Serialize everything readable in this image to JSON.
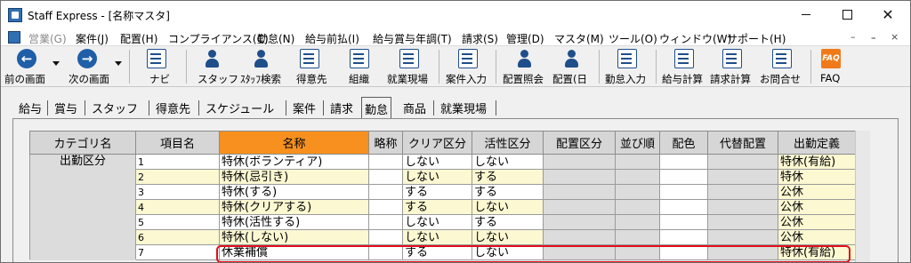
{
  "window": {
    "title": "Staff Express - [名称マスタ]",
    "controls": {
      "close": "✕"
    }
  },
  "menu": {
    "items": [
      {
        "label": "営業(G)",
        "enabled": false
      },
      {
        "label": "案件(J)",
        "enabled": true
      },
      {
        "label": "配置(H)",
        "enabled": true
      },
      {
        "label": "コンプライアンス(C)",
        "enabled": true
      },
      {
        "label": "勤怠(N)",
        "enabled": true
      },
      {
        "label": "給与前払(I)",
        "enabled": true
      },
      {
        "label": "給与賞与年調(T)",
        "enabled": true
      },
      {
        "label": "請求(S)",
        "enabled": true
      },
      {
        "label": "管理(D)",
        "enabled": true
      },
      {
        "label": "マスタ(M)",
        "enabled": true
      },
      {
        "label": "ツール(O)",
        "enabled": true
      },
      {
        "label": "ウィンドウ(W)",
        "enabled": true
      },
      {
        "label": "サポート(H)",
        "enabled": true
      }
    ],
    "mdi_controls": [
      "–",
      "ｰ",
      "×"
    ]
  },
  "toolbar": {
    "buttons": [
      {
        "label": "前の画面",
        "icon": "back-arrow-icon"
      },
      {
        "label": "次の画面",
        "icon": "forward-arrow-icon"
      },
      {
        "label": "ナビ",
        "icon": "navi-icon"
      },
      {
        "label": "スタッフ",
        "icon": "staff-icon"
      },
      {
        "label": "ｽﾀｯﾌ検索",
        "icon": "staff-search-icon"
      },
      {
        "label": "得意先",
        "icon": "customer-icon"
      },
      {
        "label": "組織",
        "icon": "organization-icon"
      },
      {
        "label": "就業現場",
        "icon": "worksite-icon"
      },
      {
        "label": "案件入力",
        "icon": "case-entry-icon"
      },
      {
        "label": "配置照会",
        "icon": "placement-inquiry-icon"
      },
      {
        "label": "配置(日",
        "icon": "placement-daily-icon"
      },
      {
        "label": "勤怠入力",
        "icon": "attendance-entry-icon"
      },
      {
        "label": "給与計算",
        "icon": "payroll-icon"
      },
      {
        "label": "請求計算",
        "icon": "billing-icon"
      },
      {
        "label": "お問合せ",
        "icon": "inquiry-icon"
      },
      {
        "label": "FAQ",
        "icon": "faq-icon",
        "icon_text": "FAQ"
      }
    ],
    "arrow_glyphs": {
      "back": "←",
      "forward": "→"
    }
  },
  "tabs": [
    {
      "label": "給与",
      "active": false
    },
    {
      "label": "賞与",
      "active": false
    },
    {
      "label": "スタッフ",
      "active": false
    },
    {
      "label": "得意先",
      "active": false
    },
    {
      "label": "スケジュール",
      "active": false
    },
    {
      "label": "案件",
      "active": false
    },
    {
      "label": "請求",
      "active": false
    },
    {
      "label": "勤怠",
      "active": true
    },
    {
      "label": "商品",
      "active": false
    },
    {
      "label": "就業現場",
      "active": false
    }
  ],
  "grid": {
    "headers": [
      "カテゴリ名",
      "項目名",
      "名称",
      "略称",
      "クリア区分",
      "活性区分",
      "配置区分",
      "並び順",
      "配色",
      "代替配置",
      "出勤定義"
    ],
    "highlight_header_index": 2,
    "category": "出勤区分",
    "rows": [
      {
        "num": "1",
        "name": "特休(ボランティア)",
        "abbr": "",
        "clear": "しない",
        "active": "しない",
        "definition": "特休(有給)"
      },
      {
        "num": "2",
        "name": "特休(忌引き)",
        "abbr": "",
        "clear": "しない",
        "active": "する",
        "definition": "特休"
      },
      {
        "num": "3",
        "name": "特休(する)",
        "abbr": "",
        "clear": "する",
        "active": "する",
        "definition": "公休"
      },
      {
        "num": "4",
        "name": "特休(クリアする)",
        "abbr": "",
        "clear": "する",
        "active": "しない",
        "definition": "公休"
      },
      {
        "num": "5",
        "name": "特休(活性する)",
        "abbr": "",
        "clear": "しない",
        "active": "する",
        "definition": "公休"
      },
      {
        "num": "6",
        "name": "特休(しない)",
        "abbr": "",
        "clear": "しない",
        "active": "しない",
        "definition": "公休"
      },
      {
        "num": "7",
        "name": "休業補償",
        "abbr": "",
        "clear": "する",
        "active": "しない",
        "definition": "特休(有給)"
      }
    ],
    "selected_row_index": 6
  },
  "colors": {
    "highlight_header": "#f7901e",
    "alt_row": "#fbf8d2",
    "selection_outline": "#e0101a"
  }
}
